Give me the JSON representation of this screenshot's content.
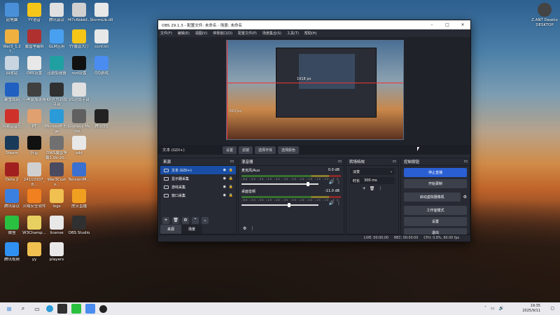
{
  "desktop": {
    "icons": [
      {
        "label": "此电脑",
        "color": "#4a90d9"
      },
      {
        "label": "YY语音",
        "color": "#f5c518"
      },
      {
        "label": "腾讯会议",
        "color": "#e0e0e0"
      },
      {
        "label": "f47c6bbbf...",
        "color": "#d0d0d0"
      },
      {
        "label": "StormLib.dll",
        "color": "#e8e8e8"
      },
      {
        "label": "War3_1.27...",
        "color": "#f0b040"
      },
      {
        "label": "魔兽争霸III",
        "color": "#b03030"
      },
      {
        "label": "GLM应用",
        "color": "#4aa0f0"
      },
      {
        "label": "YY魔兽大厅",
        "color": "#f5c518"
      },
      {
        "label": "conf.ini",
        "color": "#e8e8e8"
      },
      {
        "label": "回收站",
        "color": "#c8d4e0"
      },
      {
        "label": "OBS设置",
        "color": "#e8e8e8"
      },
      {
        "label": "迅游加速器",
        "color": "#20a0a0"
      },
      {
        "label": "nvd设置",
        "color": "#111111"
      },
      {
        "label": "QQ游戏",
        "color": "#4a8cf0"
      },
      {
        "label": "暴雪战网",
        "color": "#2060c0"
      },
      {
        "label": "小黑盒加速器",
        "color": "#404040"
      },
      {
        "label": "KK官方对战平台",
        "color": "#303030"
      },
      {
        "label": "VS对战平台",
        "color": "#e0e0e0"
      },
      {
        "label": "网易云音乐",
        "color": "#d0302a"
      },
      {
        "label": "PT",
        "color": "#e0a070"
      },
      {
        "label": "Microsoft Edge",
        "color": "#2a9ad8"
      },
      {
        "label": "Glorious Model...",
        "color": "#606060"
      },
      {
        "label": "腾讯QQ",
        "color": "#222222"
      },
      {
        "label": "Steam",
        "color": "#1a3a5a"
      },
      {
        "label": "抖音",
        "color": "#111111"
      },
      {
        "label": "DWS魔兽争霸1.0b-20...",
        "color": "#707070"
      },
      {
        "label": "sdd",
        "color": "#e8e8e8"
      },
      {
        "label": "Dota 2",
        "color": "#a02020"
      },
      {
        "label": "24110307_8...",
        "color": "#d0d0d0"
      },
      {
        "label": "War3Custo...",
        "color": "#4a4a60"
      },
      {
        "label": "TencentM...",
        "color": "#3a70d0"
      },
      {
        "label": "腾讯会议",
        "color": "#3a80e0"
      },
      {
        "label": "火绒安全软件",
        "color": "#f08020"
      },
      {
        "label": "logs",
        "color": "#f0c050"
      },
      {
        "label": "虎牙直播",
        "color": "#f0a020"
      },
      {
        "label": "微信",
        "color": "#2ac040"
      },
      {
        "label": "W3Champ...",
        "color": "#e8d060"
      },
      {
        "label": "license",
        "color": "#e8e8e8"
      },
      {
        "label": "OBS Studio",
        "color": "#303030"
      },
      {
        "label": "腾讯视频",
        "color": "#3090f0"
      },
      {
        "label": "yy",
        "color": "#f0c050"
      },
      {
        "label": "players",
        "color": "#e8e8e8"
      }
    ],
    "right_icon": {
      "label": "Z.ANT Deskto DESKTOP",
      "color": "#444444"
    }
  },
  "obs": {
    "title": "OBS 29.1.3 - 配置文件: 未命名 - 场景: 未命名",
    "menu": [
      "文件(F)",
      "编辑(E)",
      "视图(V)",
      "停靠窗口(D)",
      "配置文件(P)",
      "场景集合(S)",
      "工具(T)",
      "帮助(H)"
    ],
    "preview": {
      "label1": "1918 px",
      "label2": "610 px"
    },
    "source_bar": {
      "selected": "文本 (GDI+)",
      "buttons": [
        "设置",
        "滤镜",
        "选择字体",
        "选择颜色"
      ]
    },
    "sources": {
      "title": "来源",
      "items": [
        "文本 (GDI+)",
        "显示器采集",
        "游戏采集",
        "窗口采集"
      ]
    },
    "scene_tabs": [
      "来源",
      "场景"
    ],
    "mixer": {
      "title": "混音器",
      "channels": [
        {
          "name": "麦克风/Aux",
          "level": "0.0 dB",
          "fader": 0.88
        },
        {
          "name": "桌面音频",
          "level": "-11.0 dB",
          "fader": 0.62
        }
      ],
      "scale": "-60 -55 -50 -45 -40 -35 -30 -25 -20 -15 -10 -5 0"
    },
    "transitions": {
      "title": "转场特效",
      "type": "淡变",
      "duration_label": "时长",
      "duration": "300 ms"
    },
    "controls": {
      "title": "控制按钮",
      "buttons": [
        "停止直播",
        "开始录制",
        "启动虚拟摄像机",
        "工作室模式",
        "设置",
        "退出"
      ]
    },
    "status": {
      "live": "LIVE: 00:00:00",
      "rec": "REC: 00:00:00",
      "cpu": "CPU: 0.8%, 60.00 fps"
    }
  },
  "taskbar": {
    "time": "19:35",
    "date": "2025/9/11"
  }
}
